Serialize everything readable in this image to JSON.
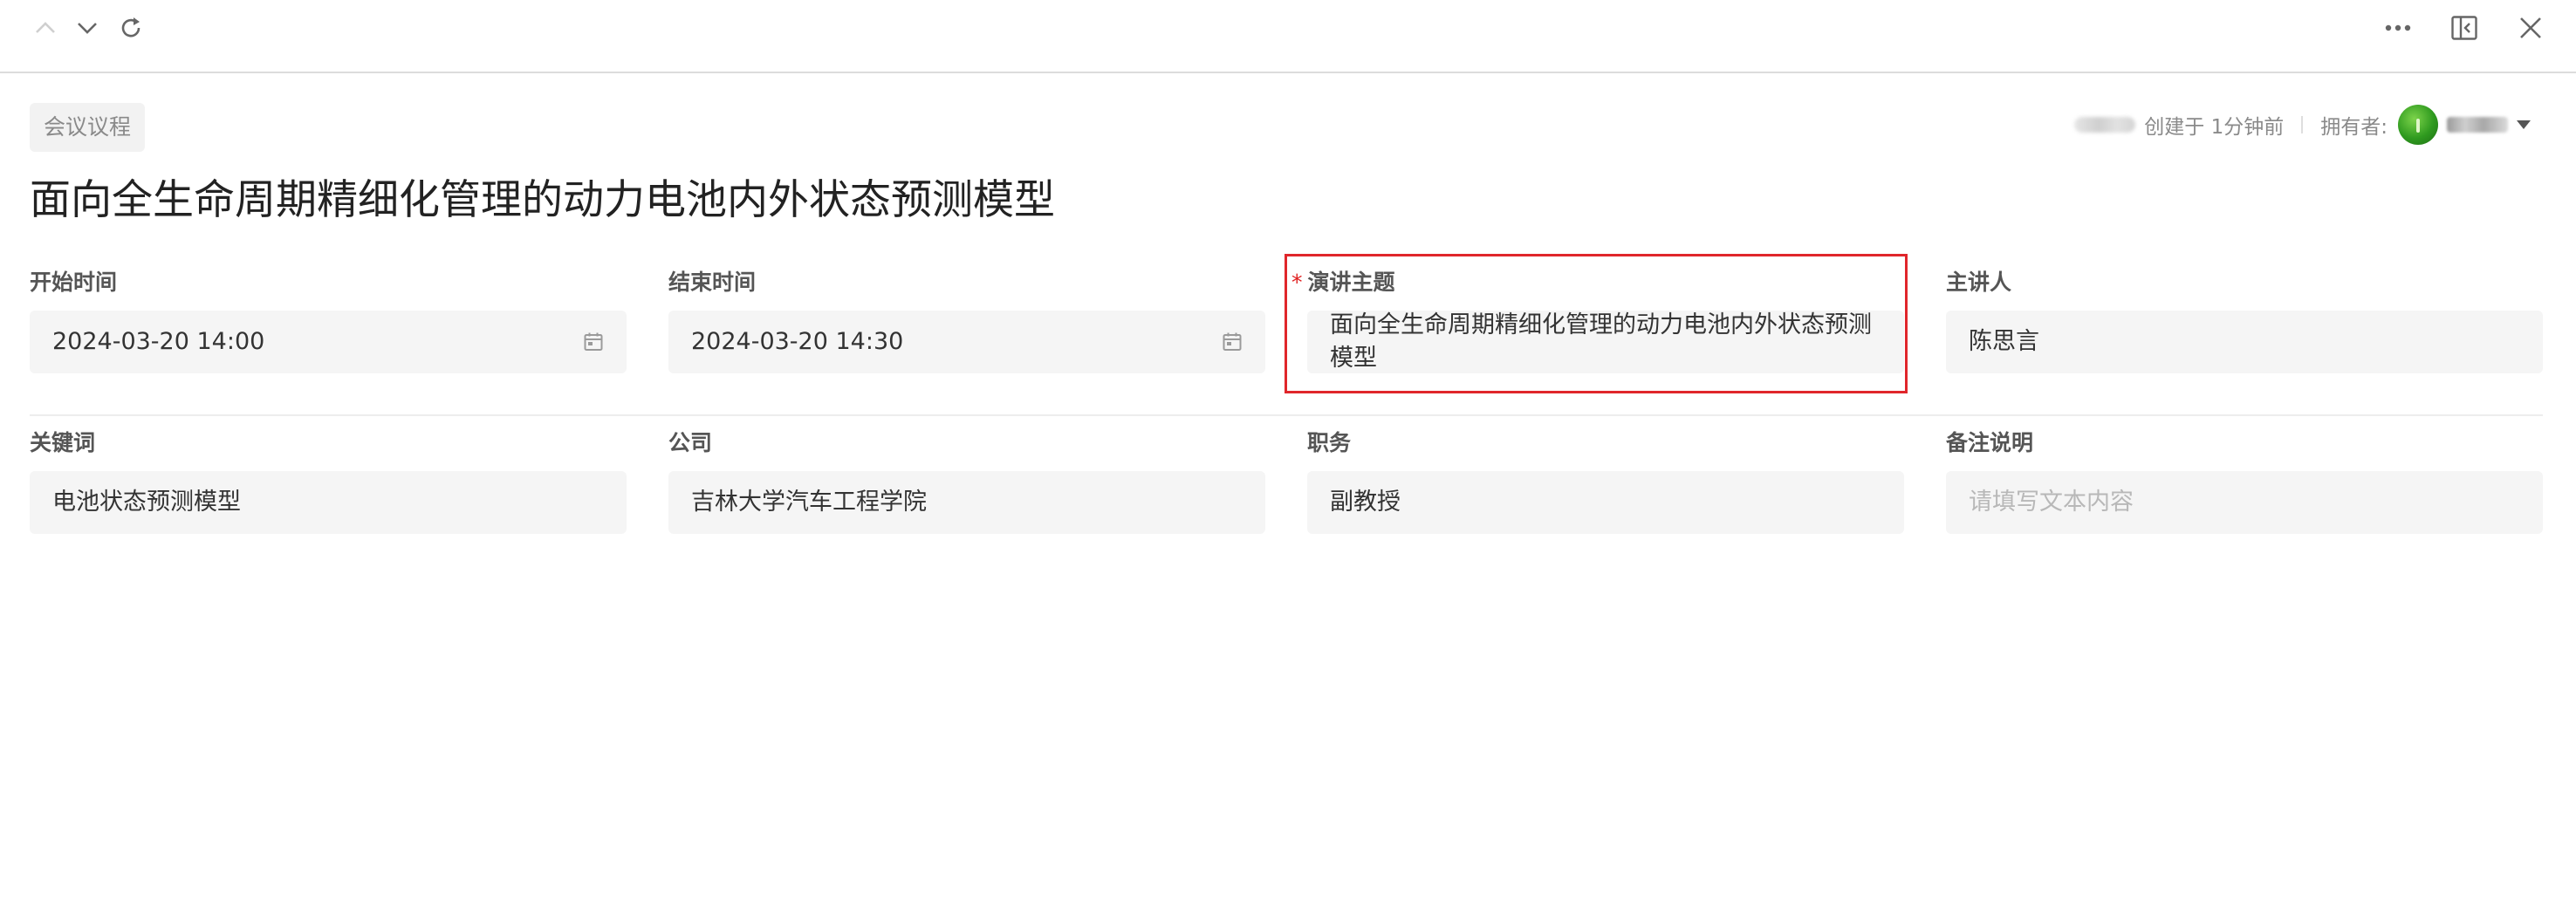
{
  "toolbar": {
    "up_icon": "chevron-up-icon",
    "down_icon": "chevron-down-icon",
    "refresh_icon": "refresh-icon",
    "more_icon": "more-dots-icon",
    "panel_icon": "collapse-panel-icon",
    "close_icon": "close-icon"
  },
  "header": {
    "tag": "会议议程",
    "created_text": "创建于 1分钟前",
    "owner_label": "拥有者:",
    "title": "面向全生命周期精细化管理的动力电池内外状态预测模型"
  },
  "fields": {
    "start_time": {
      "label": "开始时间",
      "value": "2024-03-20 14:00"
    },
    "end_time": {
      "label": "结束时间",
      "value": "2024-03-20 14:30"
    },
    "topic": {
      "required_mark": "*",
      "label": "演讲主题",
      "value": "面向全生命周期精细化管理的动力电池内外状态预测模型"
    },
    "speaker": {
      "label": "主讲人",
      "value": "陈思言"
    },
    "keywords": {
      "label": "关键词",
      "value": "电池状态预测模型"
    },
    "company": {
      "label": "公司",
      "value": "吉林大学汽车工程学院"
    },
    "position": {
      "label": "职务",
      "value": "副教授"
    },
    "notes": {
      "label": "备注说明",
      "placeholder": "请填写文本内容"
    }
  },
  "colors": {
    "highlight_border": "#e0262b",
    "required": "#e02020",
    "avatar": "#2f9a1f"
  }
}
